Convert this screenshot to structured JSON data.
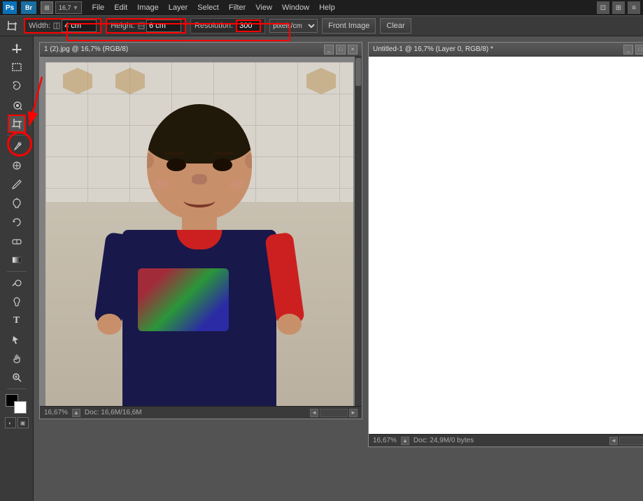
{
  "app": {
    "name": "Adobe Photoshop",
    "ps_label": "Ps"
  },
  "menu": {
    "items": [
      "File",
      "Edit",
      "Image",
      "Layer",
      "Select",
      "Filter",
      "View",
      "Window",
      "Help"
    ]
  },
  "bridge_icon": "Br",
  "options_bar": {
    "width_label": "Width:",
    "width_value": "4 cm",
    "height_label": "Height:",
    "height_value": "6 cm",
    "resolution_label": "Resolution:",
    "resolution_value": "300",
    "unit": "pixels/cm",
    "front_image_btn": "Front Image",
    "clear_btn": "Clear"
  },
  "doc1": {
    "title": "1 (2).jpg @ 16,7% (RGB/8)",
    "zoom": "16,67%",
    "status": "Doc: 16,6M/16,6M"
  },
  "doc2": {
    "title": "Untitled-1 @ 16,7% (Layer 0, RGB/8) *",
    "zoom": "16,67%",
    "status": "Doc: 24,9M/0 bytes"
  },
  "toolbar": {
    "tools": [
      {
        "name": "move-tool",
        "icon": "✥"
      },
      {
        "name": "rectangular-marquee-tool",
        "icon": "⬚"
      },
      {
        "name": "lasso-tool",
        "icon": "⌒"
      },
      {
        "name": "quick-selection-tool",
        "icon": "⊘"
      },
      {
        "name": "crop-tool",
        "icon": "⊡",
        "highlighted": true
      },
      {
        "name": "eyedropper-tool",
        "icon": "⊿"
      },
      {
        "name": "healing-brush-tool",
        "icon": "✚"
      },
      {
        "name": "brush-tool",
        "icon": "✏"
      },
      {
        "name": "clone-stamp-tool",
        "icon": "✉"
      },
      {
        "name": "history-brush-tool",
        "icon": "↺"
      },
      {
        "name": "eraser-tool",
        "icon": "◻"
      },
      {
        "name": "gradient-tool",
        "icon": "▣"
      },
      {
        "name": "dodge-tool",
        "icon": "○"
      },
      {
        "name": "pen-tool",
        "icon": "✒"
      },
      {
        "name": "text-tool",
        "icon": "T"
      },
      {
        "name": "path-selection-tool",
        "icon": "↗"
      },
      {
        "name": "hand-tool",
        "icon": "✋"
      },
      {
        "name": "zoom-tool",
        "icon": "⊕"
      }
    ]
  }
}
